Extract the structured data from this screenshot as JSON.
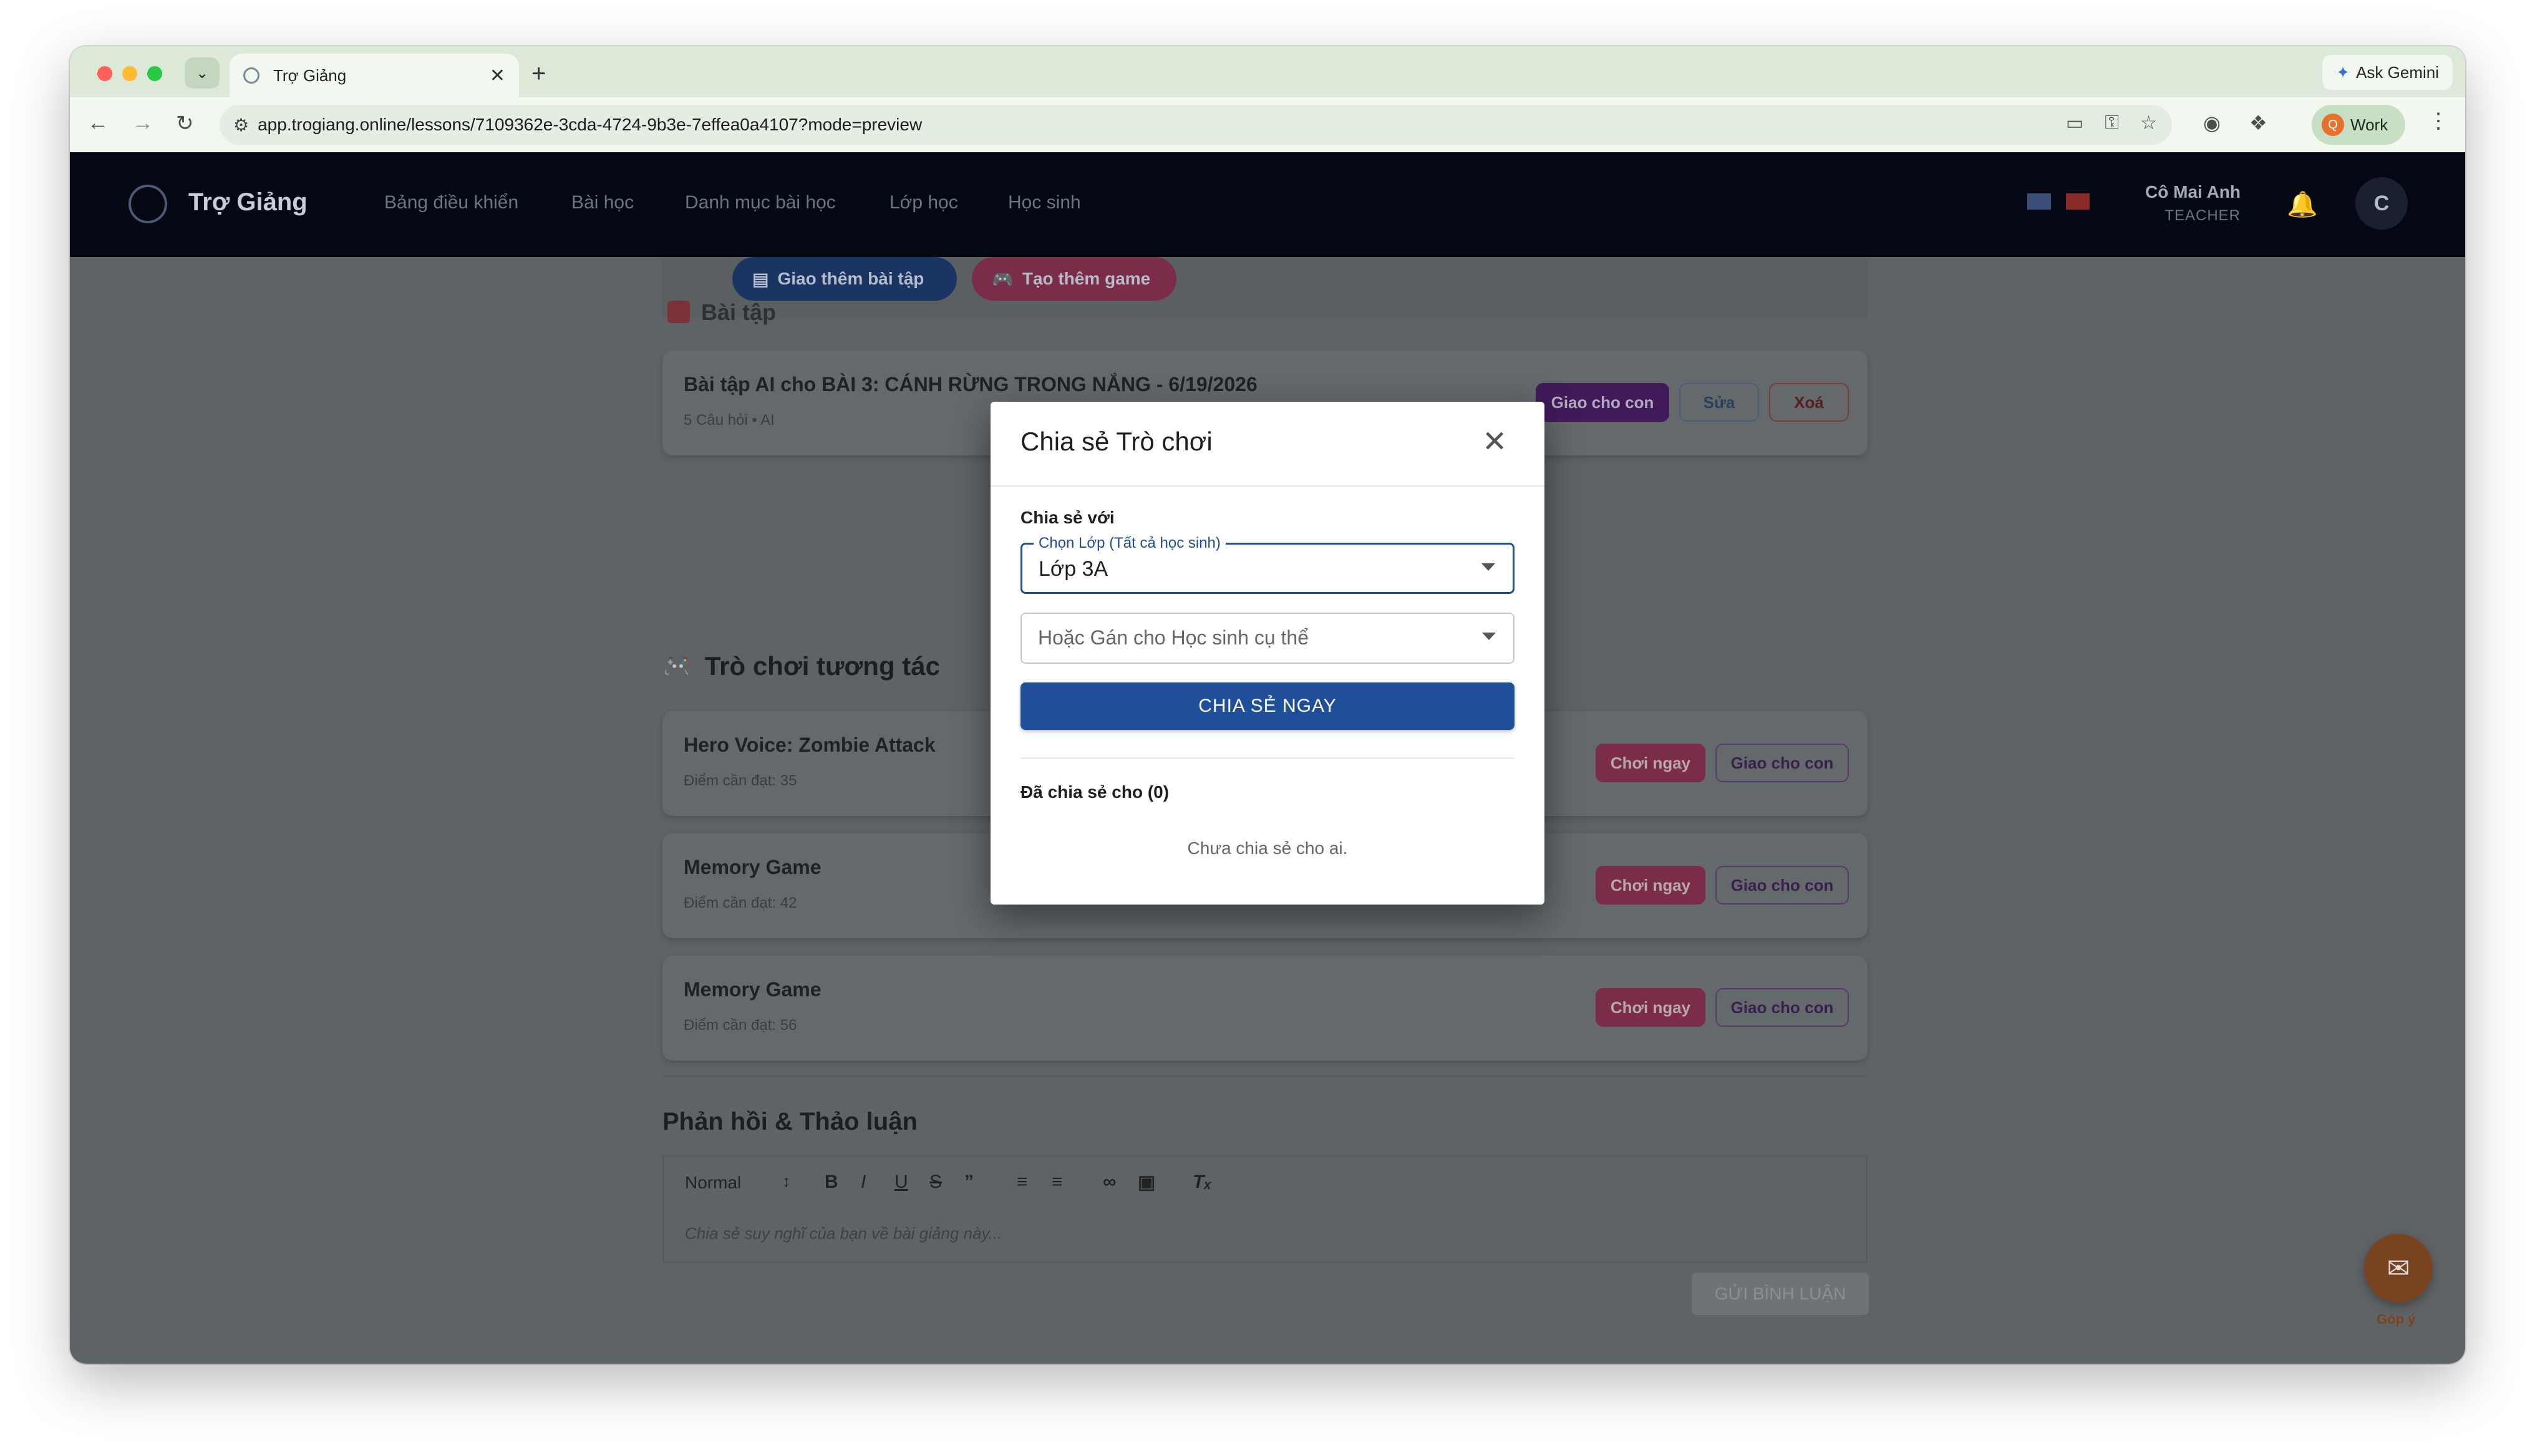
{
  "browser": {
    "tab_title": "Trợ Giảng",
    "url": "app.trogiang.online/lessons/7109362e-3cda-4724-9b3e-7effea0a4107?mode=preview",
    "ask_gemini": "Ask Gemini",
    "profile_initial": "Q",
    "profile_label": "Work"
  },
  "nav": {
    "brand": "Trợ Giảng",
    "links": [
      "Bảng điều khiển",
      "Bài học",
      "Danh mục bài học",
      "Lớp học",
      "Học sinh"
    ],
    "user_name": "Cô Mai Anh",
    "user_role": "TEACHER",
    "avatar_initial": "C"
  },
  "page": {
    "assign_more_label": "Giao thêm bài tập",
    "create_game_label": "Tạo thêm game",
    "partial_section_title": "Bài tập",
    "exercise": {
      "title": "Bài tập AI cho BÀI 3: CÁNH RỪNG TRONG NẮNG - 6/19/2026",
      "meta": "5 Câu hỏi • AI",
      "assign_label": "Giao cho con",
      "edit_label": "Sửa",
      "delete_label": "Xoá"
    },
    "games_section_title": "Trò chơi tương tác",
    "games": [
      {
        "title": "Hero Voice: Zombie Attack",
        "score": "Điểm cần đạt: 35",
        "play_label": "Chơi ngay",
        "assign_label": "Giao cho con"
      },
      {
        "title": "Memory Game",
        "score": "Điểm cần đạt: 42",
        "play_label": "Chơi ngay",
        "assign_label": "Giao cho con"
      },
      {
        "title": "Memory Game",
        "score": "Điểm cần đạt: 56",
        "play_label": "Chơi ngay",
        "assign_label": "Giao cho con"
      }
    ],
    "feedback_title": "Phản hồi & Thảo luận",
    "editor_style": "Normal",
    "editor_placeholder": "Chia sẻ suy nghĩ của bạn về bài giảng này...",
    "send_label": "GỬI BÌNH LUẬN",
    "fab_label": "Góp ý"
  },
  "modal": {
    "title": "Chia sẻ Trò chơi",
    "share_with_label": "Chia sẻ với",
    "class_select_label": "Chọn Lớp (Tất cả học sinh)",
    "class_select_value": "Lớp 3A",
    "student_select_placeholder": "Hoặc Gán cho Học sinh cụ thể",
    "share_button": "CHIA SẺ NGAY",
    "shared_with_heading": "Đã chia sẻ cho (0)",
    "empty_text": "Chưa chia sẻ cho ai."
  },
  "colors": {
    "nav_bg": "#030812",
    "primary_blue": "#1f4e9a",
    "assign_purple": "#7b1fa2",
    "game_pink": "#d6336c",
    "delete_red": "#c62828"
  }
}
